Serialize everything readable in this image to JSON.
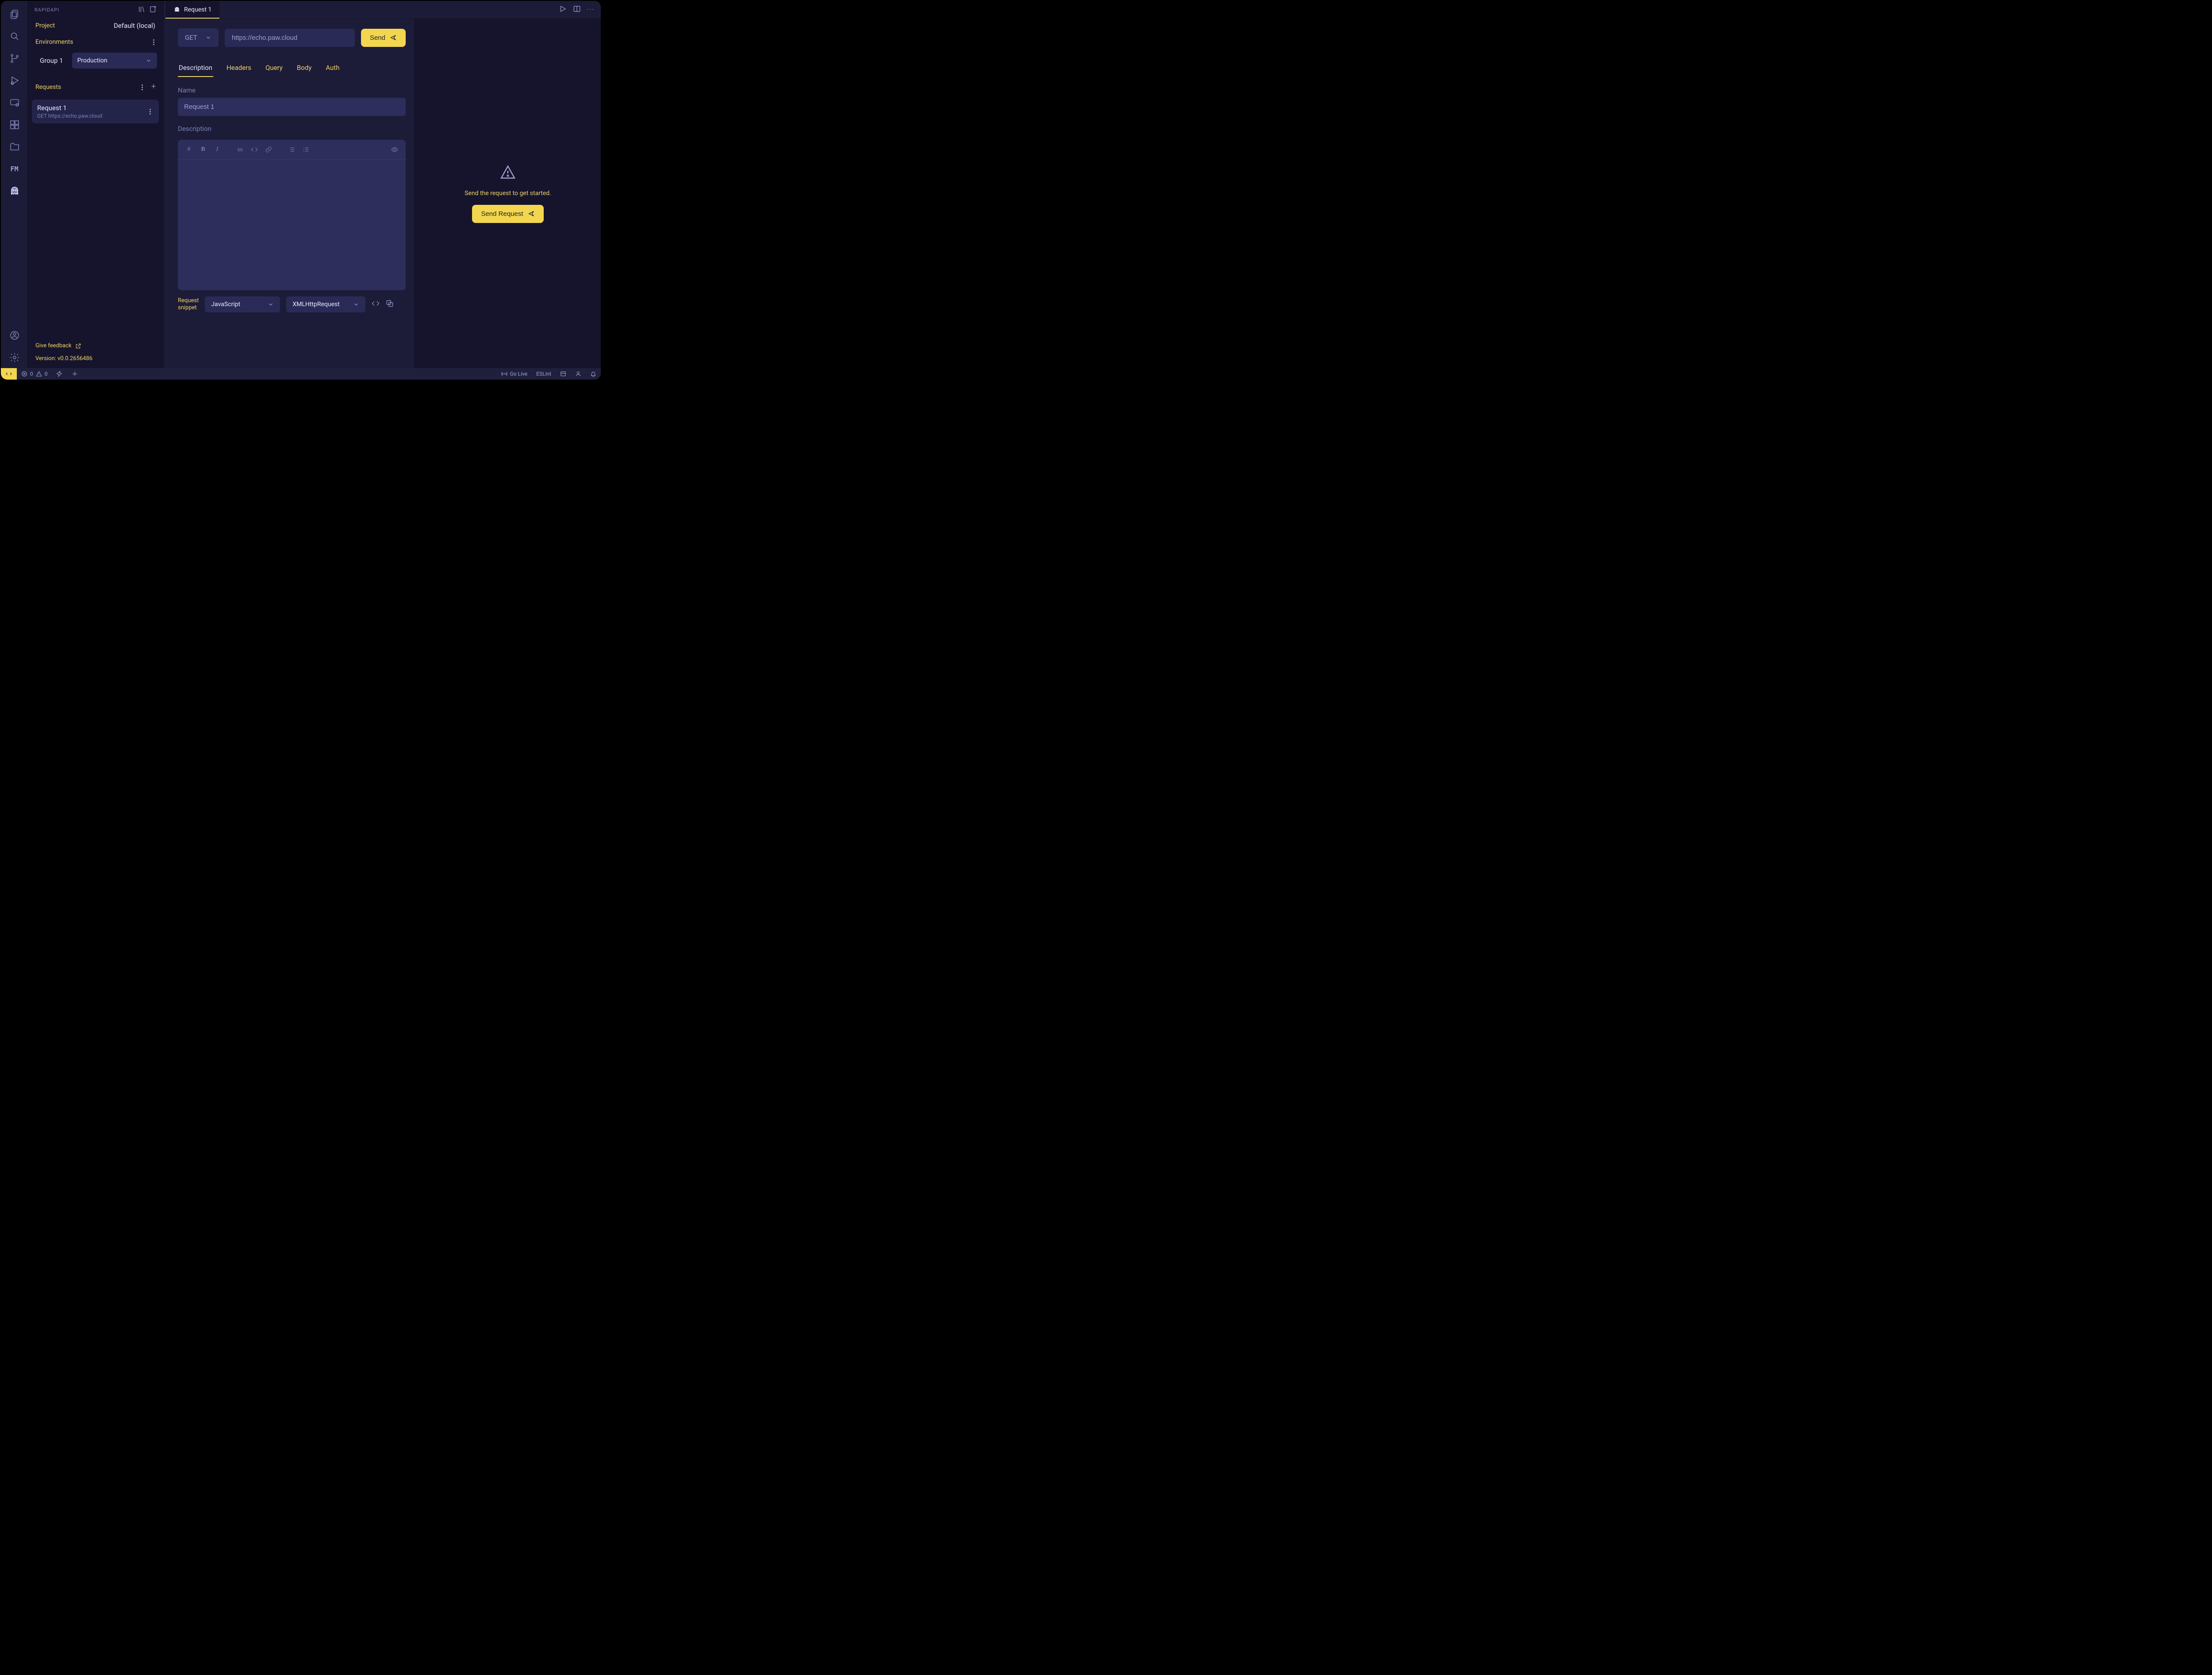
{
  "colors": {
    "yellow": "#EDD167",
    "yellow_bright": "#F3D64F",
    "bg": "#1C1C38",
    "bg_deep": "#15142C",
    "panel": "#24244A",
    "input": "#2E2E5C"
  },
  "activity_bar": {
    "items": [
      {
        "name": "files-icon"
      },
      {
        "name": "search-icon"
      },
      {
        "name": "git-branch-icon"
      },
      {
        "name": "run-debug-icon"
      },
      {
        "name": "remote-explorer-icon"
      },
      {
        "name": "extensions-icon"
      },
      {
        "name": "folder-icon"
      },
      {
        "name": "fm-icon",
        "label": "FM"
      },
      {
        "name": "rapidapi-ghost-icon"
      }
    ],
    "bottom": [
      {
        "name": "account-icon"
      },
      {
        "name": "settings-gear-icon"
      }
    ]
  },
  "side": {
    "title": "RAPIDAPI",
    "project_label": "Project",
    "project_value": "Default (local)",
    "env_label": "Environments",
    "group_label": "Group 1",
    "env_selected": "Production",
    "requests_label": "Requests",
    "requests": [
      {
        "title": "Request 1",
        "method": "GET",
        "url": "https://echo.paw.cloud"
      }
    ],
    "feedback": "Give feedback",
    "version": "Version: v0.0.2656486"
  },
  "tabs": [
    {
      "label": "Request 1"
    }
  ],
  "request": {
    "method": "GET",
    "url": "https://echo.paw.cloud",
    "send_label": "Send",
    "subtabs": [
      "Description",
      "Headers",
      "Query",
      "Body",
      "Auth"
    ],
    "active_subtab": "Description",
    "name_label": "Name",
    "name_value": "Request 1",
    "description_label": "Description",
    "snippet_label": "Request\nsnippet",
    "snippet_language": "JavaScript",
    "snippet_library": "XMLHttpRequest"
  },
  "response": {
    "message": "Send the request to get started.",
    "button": "Send Request"
  },
  "status_bar": {
    "errors": "0",
    "warnings": "0",
    "go_live": "Go Live",
    "eslint": "ESLint"
  }
}
